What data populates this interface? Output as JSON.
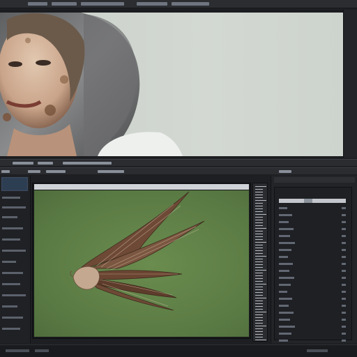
{
  "app": {
    "menu_items": [
      "",
      "",
      "",
      "",
      "",
      "",
      ""
    ]
  },
  "upper_viewport": {
    "subject": "render-preview-woman-hooded"
  },
  "main_viewport": {
    "subject": "3d-model-feathered-creature",
    "background_color": "#5a7a44"
  },
  "icons": {
    "outliner_toggle": "checkbox-icon",
    "timeline": "ruler-ticks"
  },
  "colors": {
    "ui_dark": "#1e1f22",
    "panel": "#232428",
    "viewport_green": "#5a7a44",
    "selection_row": "#c3c7cd"
  }
}
